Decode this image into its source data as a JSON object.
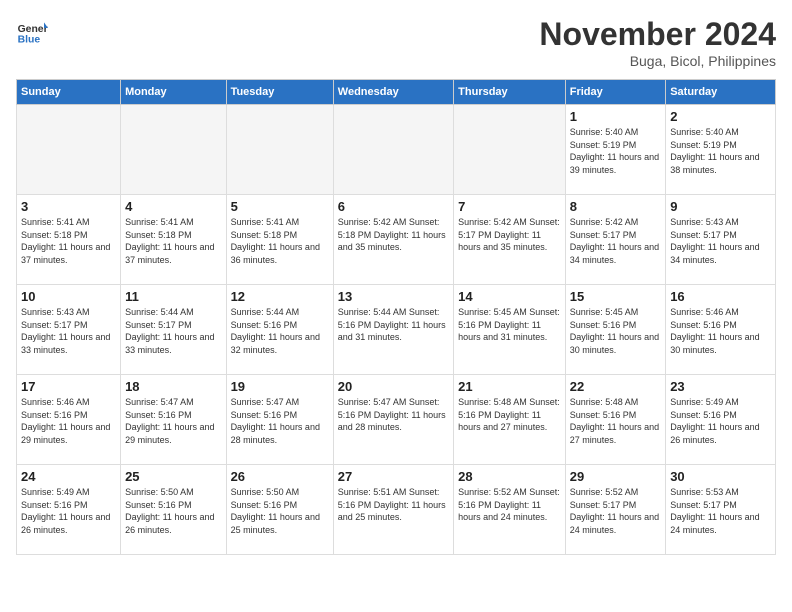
{
  "logo": {
    "line1": "General",
    "line2": "Blue"
  },
  "title": "November 2024",
  "subtitle": "Buga, Bicol, Philippines",
  "days_of_week": [
    "Sunday",
    "Monday",
    "Tuesday",
    "Wednesday",
    "Thursday",
    "Friday",
    "Saturday"
  ],
  "weeks": [
    [
      {
        "day": "",
        "info": ""
      },
      {
        "day": "",
        "info": ""
      },
      {
        "day": "",
        "info": ""
      },
      {
        "day": "",
        "info": ""
      },
      {
        "day": "",
        "info": ""
      },
      {
        "day": "1",
        "info": "Sunrise: 5:40 AM\nSunset: 5:19 PM\nDaylight: 11 hours\nand 39 minutes."
      },
      {
        "day": "2",
        "info": "Sunrise: 5:40 AM\nSunset: 5:19 PM\nDaylight: 11 hours\nand 38 minutes."
      }
    ],
    [
      {
        "day": "3",
        "info": "Sunrise: 5:41 AM\nSunset: 5:18 PM\nDaylight: 11 hours\nand 37 minutes."
      },
      {
        "day": "4",
        "info": "Sunrise: 5:41 AM\nSunset: 5:18 PM\nDaylight: 11 hours\nand 37 minutes."
      },
      {
        "day": "5",
        "info": "Sunrise: 5:41 AM\nSunset: 5:18 PM\nDaylight: 11 hours\nand 36 minutes."
      },
      {
        "day": "6",
        "info": "Sunrise: 5:42 AM\nSunset: 5:18 PM\nDaylight: 11 hours\nand 35 minutes."
      },
      {
        "day": "7",
        "info": "Sunrise: 5:42 AM\nSunset: 5:17 PM\nDaylight: 11 hours\nand 35 minutes."
      },
      {
        "day": "8",
        "info": "Sunrise: 5:42 AM\nSunset: 5:17 PM\nDaylight: 11 hours\nand 34 minutes."
      },
      {
        "day": "9",
        "info": "Sunrise: 5:43 AM\nSunset: 5:17 PM\nDaylight: 11 hours\nand 34 minutes."
      }
    ],
    [
      {
        "day": "10",
        "info": "Sunrise: 5:43 AM\nSunset: 5:17 PM\nDaylight: 11 hours\nand 33 minutes."
      },
      {
        "day": "11",
        "info": "Sunrise: 5:44 AM\nSunset: 5:17 PM\nDaylight: 11 hours\nand 33 minutes."
      },
      {
        "day": "12",
        "info": "Sunrise: 5:44 AM\nSunset: 5:16 PM\nDaylight: 11 hours\nand 32 minutes."
      },
      {
        "day": "13",
        "info": "Sunrise: 5:44 AM\nSunset: 5:16 PM\nDaylight: 11 hours\nand 31 minutes."
      },
      {
        "day": "14",
        "info": "Sunrise: 5:45 AM\nSunset: 5:16 PM\nDaylight: 11 hours\nand 31 minutes."
      },
      {
        "day": "15",
        "info": "Sunrise: 5:45 AM\nSunset: 5:16 PM\nDaylight: 11 hours\nand 30 minutes."
      },
      {
        "day": "16",
        "info": "Sunrise: 5:46 AM\nSunset: 5:16 PM\nDaylight: 11 hours\nand 30 minutes."
      }
    ],
    [
      {
        "day": "17",
        "info": "Sunrise: 5:46 AM\nSunset: 5:16 PM\nDaylight: 11 hours\nand 29 minutes."
      },
      {
        "day": "18",
        "info": "Sunrise: 5:47 AM\nSunset: 5:16 PM\nDaylight: 11 hours\nand 29 minutes."
      },
      {
        "day": "19",
        "info": "Sunrise: 5:47 AM\nSunset: 5:16 PM\nDaylight: 11 hours\nand 28 minutes."
      },
      {
        "day": "20",
        "info": "Sunrise: 5:47 AM\nSunset: 5:16 PM\nDaylight: 11 hours\nand 28 minutes."
      },
      {
        "day": "21",
        "info": "Sunrise: 5:48 AM\nSunset: 5:16 PM\nDaylight: 11 hours\nand 27 minutes."
      },
      {
        "day": "22",
        "info": "Sunrise: 5:48 AM\nSunset: 5:16 PM\nDaylight: 11 hours\nand 27 minutes."
      },
      {
        "day": "23",
        "info": "Sunrise: 5:49 AM\nSunset: 5:16 PM\nDaylight: 11 hours\nand 26 minutes."
      }
    ],
    [
      {
        "day": "24",
        "info": "Sunrise: 5:49 AM\nSunset: 5:16 PM\nDaylight: 11 hours\nand 26 minutes."
      },
      {
        "day": "25",
        "info": "Sunrise: 5:50 AM\nSunset: 5:16 PM\nDaylight: 11 hours\nand 26 minutes."
      },
      {
        "day": "26",
        "info": "Sunrise: 5:50 AM\nSunset: 5:16 PM\nDaylight: 11 hours\nand 25 minutes."
      },
      {
        "day": "27",
        "info": "Sunrise: 5:51 AM\nSunset: 5:16 PM\nDaylight: 11 hours\nand 25 minutes."
      },
      {
        "day": "28",
        "info": "Sunrise: 5:52 AM\nSunset: 5:16 PM\nDaylight: 11 hours\nand 24 minutes."
      },
      {
        "day": "29",
        "info": "Sunrise: 5:52 AM\nSunset: 5:17 PM\nDaylight: 11 hours\nand 24 minutes."
      },
      {
        "day": "30",
        "info": "Sunrise: 5:53 AM\nSunset: 5:17 PM\nDaylight: 11 hours\nand 24 minutes."
      }
    ]
  ]
}
